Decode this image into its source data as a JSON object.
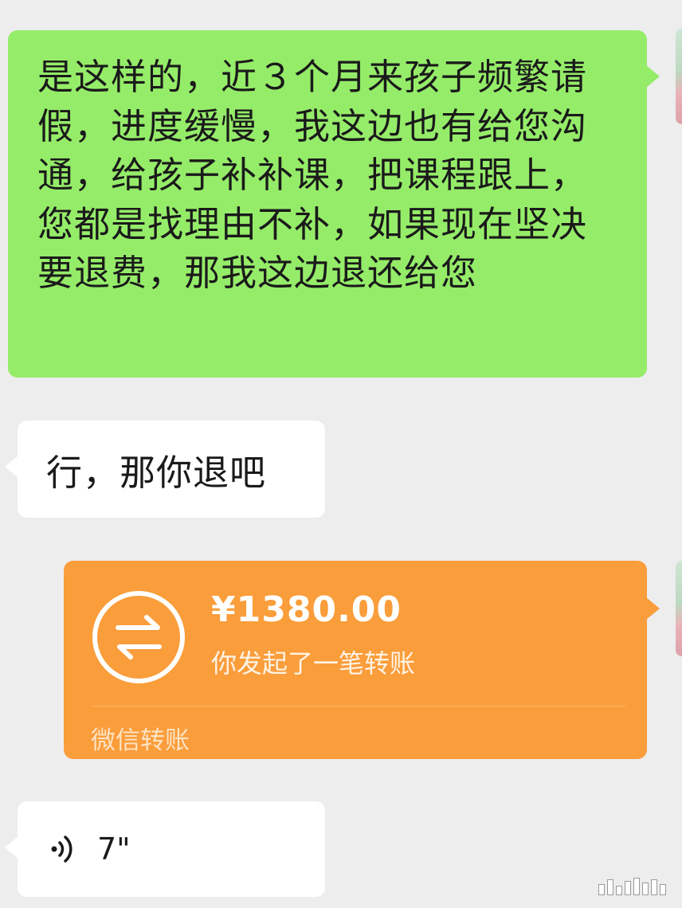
{
  "chat": {
    "messages": [
      {
        "type": "text",
        "direction": "outgoing",
        "text": "是这样的，近３个月来孩子频繁请假，进度缓慢，我这边也有给您沟通，给孩子补补课，把课程跟上，您都是找理由不补，如果现在坚决要退费，那我这边退还给您"
      },
      {
        "type": "text",
        "direction": "incoming",
        "text": "行，那你退吧"
      },
      {
        "type": "transfer",
        "direction": "outgoing",
        "amount": "¥1380.00",
        "description": "你发起了一笔转账",
        "footer": "微信转账",
        "icon": "transfer-arrows-icon"
      },
      {
        "type": "voice",
        "direction": "incoming",
        "duration": "7\"",
        "icon": "voice-wave-icon"
      }
    ]
  },
  "colors": {
    "background": "#ededed",
    "outgoing_bubble": "#95ec69",
    "incoming_bubble": "#ffffff",
    "transfer_card": "#fa9d3b"
  }
}
